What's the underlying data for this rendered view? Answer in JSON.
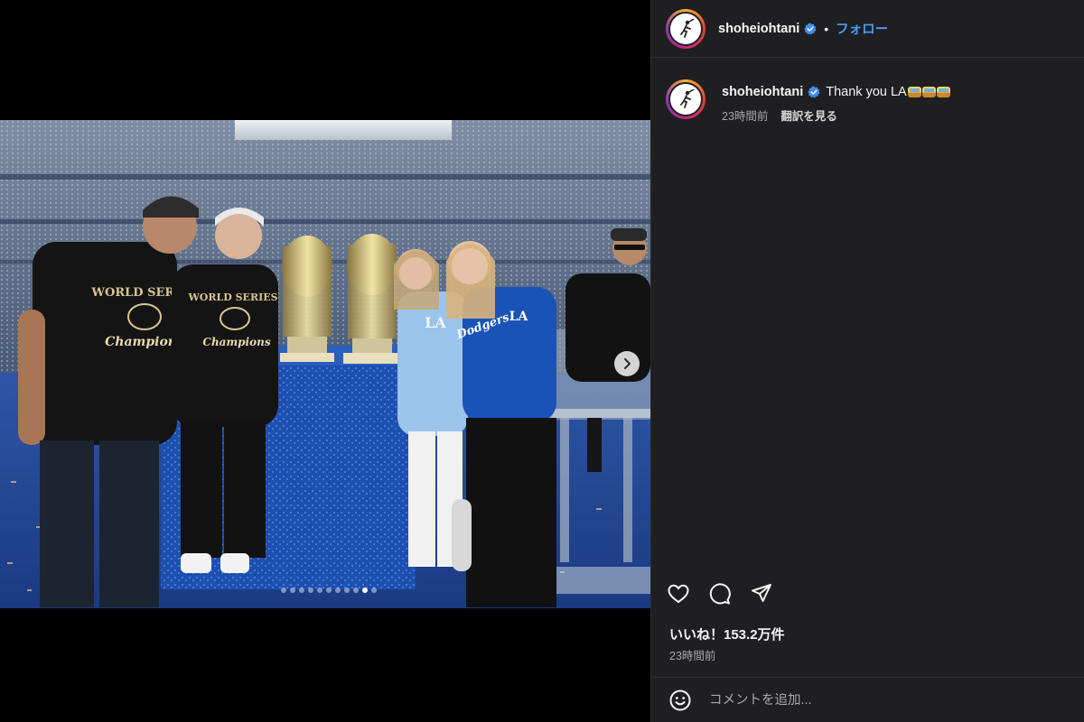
{
  "post": {
    "username": "shoheiohtani",
    "separator": "•",
    "follow_label": "フォロー",
    "caption": "Thank you LA",
    "caption_emoji": "tram-car-emoji",
    "caption_time": "23時間前",
    "translate_label": "翻訳を見る",
    "likes": "いいね！153.2万件",
    "post_time": "23時間前",
    "comment_placeholder": "コメントを追加..."
  },
  "carousel": {
    "total_slides": 11,
    "active_index": 9,
    "photo_text": {
      "shirt_line1": "WORLD SERIES",
      "shirt_line2": "Champions",
      "jacket_logo": "LA",
      "jacket_script": "Dodgers"
    }
  },
  "icons": {
    "header_avatar": "batter-silhouette-icon",
    "verified": "verified-badge-icon",
    "next": "chevron-right-icon",
    "like": "heart-icon",
    "comment": "comment-bubble-icon",
    "share": "paper-plane-icon",
    "emoji": "smiley-face-icon"
  },
  "colors": {
    "sidebar_bg": "#1f1f22",
    "accent_blue": "#4a9cf5",
    "muted_text": "#a8a8a8",
    "dodger_blue": "#1a53b8"
  }
}
